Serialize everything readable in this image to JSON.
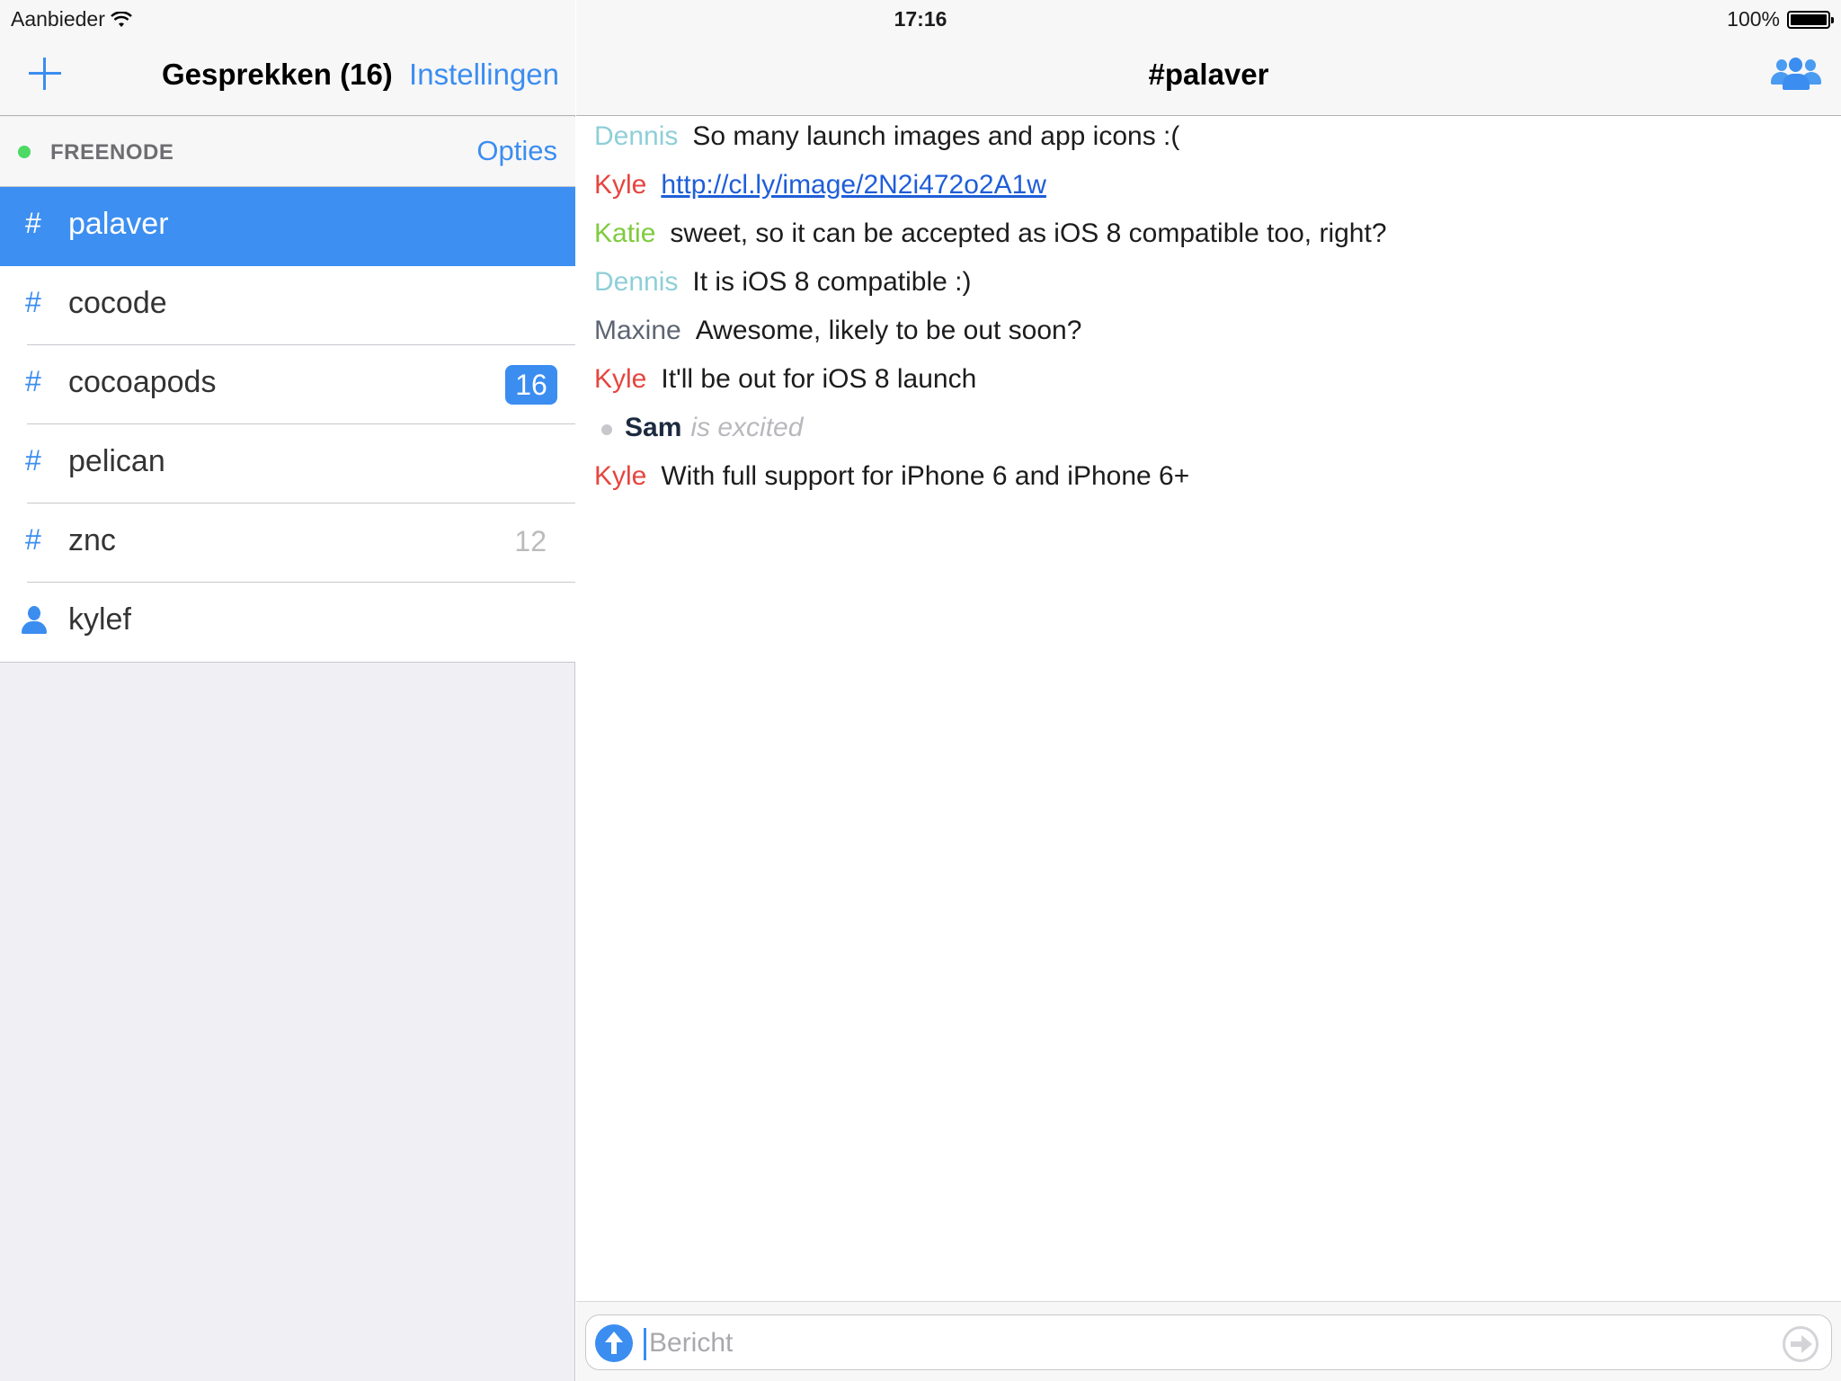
{
  "status_bar": {
    "carrier": "Aanbieder",
    "time": "17:16",
    "battery": "100%",
    "battery_level": 1.0
  },
  "sidebar": {
    "title": "Gesprekken (16)",
    "settings_label": "Instellingen",
    "network": {
      "name": "FREENODE",
      "options_label": "Opties",
      "status_color": "#4cd964"
    },
    "channels": [
      {
        "symbol": "#",
        "name": "palaver",
        "selected": true,
        "badge": ""
      },
      {
        "symbol": "#",
        "name": "cocode",
        "badge": ""
      },
      {
        "symbol": "#",
        "name": "cocoapods",
        "badge": "16"
      },
      {
        "symbol": "#",
        "name": "pelican",
        "badge": ""
      },
      {
        "symbol": "#",
        "name": "znc",
        "muted_count": "12"
      },
      {
        "symbol": "user-icon",
        "name": "kylef"
      }
    ]
  },
  "chat": {
    "title": "#palaver",
    "messages": [
      {
        "nick": "Dennis",
        "nick_color": "#8fcfd8",
        "text": "So many launch images and app icons :("
      },
      {
        "nick": "Kyle",
        "nick_color": "#e6453f",
        "link": "http://cl.ly/image/2N2i472o2A1w"
      },
      {
        "nick": "Katie",
        "nick_color": "#7fcb3f",
        "text": "sweet, so it can be accepted as iOS 8 compatible too, right?"
      },
      {
        "nick": "Dennis",
        "nick_color": "#8fcfd8",
        "text": "It is iOS 8 compatible :)"
      },
      {
        "nick": "Maxine",
        "nick_color": "#5d6573",
        "text": "Awesome, likely to be out soon?"
      },
      {
        "nick": "Kyle",
        "nick_color": "#e6453f",
        "text": "It'll be out for iOS 8 launch"
      },
      {
        "nick": "Sam",
        "action": "is excited"
      },
      {
        "nick": "Kyle",
        "nick_color": "#e6453f",
        "text": "With full support for iPhone 6 and iPhone 6+"
      }
    ],
    "input": {
      "placeholder": "Bericht",
      "value": ""
    }
  },
  "colors": {
    "accent": "#3b8df0",
    "selected_row": "#3d8ff1"
  }
}
